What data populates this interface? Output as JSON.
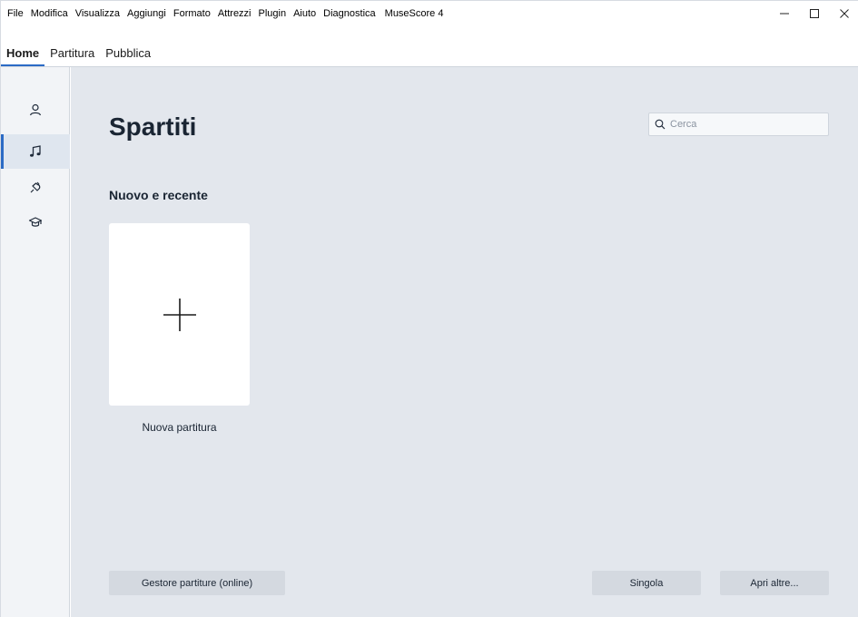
{
  "menu": {
    "items": [
      "File",
      "Modifica",
      "Visualizza",
      "Aggiungi",
      "Formato",
      "Attrezzi",
      "Plugin",
      "Aiuto",
      "Diagnostica"
    ],
    "app_name": "MuseScore 4"
  },
  "window_controls": {
    "minimize": "—",
    "maximize": "☐",
    "close": "✕"
  },
  "tabs": [
    {
      "label": "Home",
      "active": true
    },
    {
      "label": "Partitura",
      "active": false
    },
    {
      "label": "Pubblica",
      "active": false
    }
  ],
  "sidebar": {
    "items": [
      {
        "icon": "account-icon",
        "active": false
      },
      {
        "icon": "music-note-icon",
        "active": true
      },
      {
        "icon": "plugin-icon",
        "active": false
      },
      {
        "icon": "learn-icon",
        "active": false
      }
    ]
  },
  "main": {
    "title": "Spartiti",
    "search_placeholder": "Cerca",
    "section_title": "Nuovo e recente",
    "new_score_label": "Nuova partitura",
    "buttons": {
      "score_manager": "Gestore partiture (online)",
      "single": "Singola",
      "open_other": "Apri altre..."
    }
  },
  "colors": {
    "accent": "#2b6bc5",
    "main_bg": "#e3e7ed",
    "sidebar_bg": "#f2f4f7",
    "button_bg": "#d4d9e0"
  }
}
